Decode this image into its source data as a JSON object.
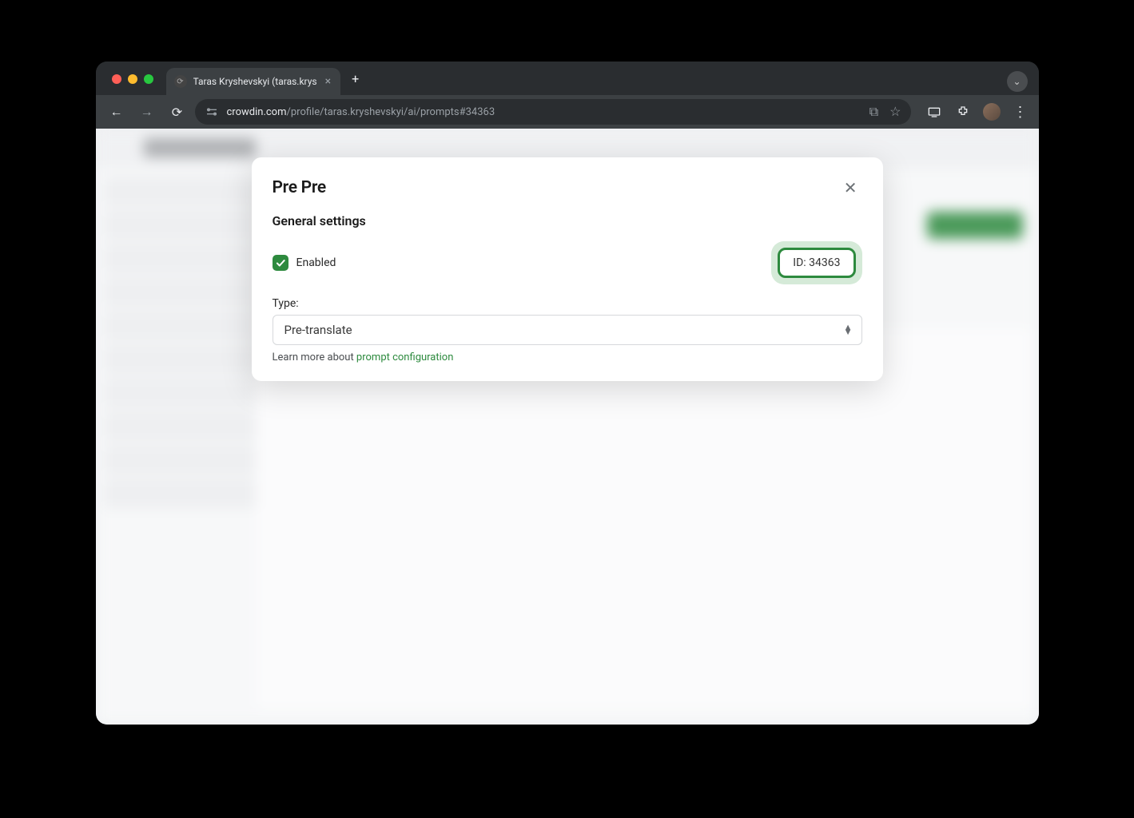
{
  "browser": {
    "tab_title": "Taras Kryshevskyi (taras.krys",
    "url_domain": "crowdin.com",
    "url_path": "/profile/taras.kryshevskyi/ai/prompts#34363"
  },
  "modal": {
    "title": "Pre Pre",
    "section_general": "General settings",
    "enabled_label": "Enabled",
    "enabled_checked": true,
    "id_badge": "ID: 34363",
    "type_label": "Type:",
    "type_value": "Pre-translate",
    "help_prefix": "Learn more about ",
    "help_link": "prompt configuration"
  }
}
